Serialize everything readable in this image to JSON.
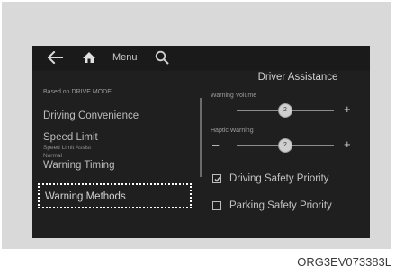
{
  "nav": {
    "menu_label": "Menu"
  },
  "panel": {
    "title": "Driver Assistance"
  },
  "left_menu": {
    "section_caption": "Based on DRIVE MODE",
    "items": [
      {
        "label": "Driving Convenience",
        "sub": ""
      },
      {
        "label": "Speed Limit",
        "sub": "Speed Limit Assist"
      },
      {
        "label": "Warning Timing",
        "sub": "Normal"
      },
      {
        "label": "Warning Methods",
        "sub": ""
      }
    ]
  },
  "right_panel": {
    "sliders": [
      {
        "label": "Warning Volume",
        "minus": "–",
        "plus": "+",
        "value": "2",
        "level": 2,
        "max": 4
      },
      {
        "label": "Haptic Warning",
        "minus": "–",
        "plus": "+",
        "value": "2",
        "level": 2,
        "max": 4
      }
    ],
    "options": [
      {
        "label": "Driving Safety Priority",
        "checked": true
      },
      {
        "label": "Parking Safety Priority",
        "checked": false
      }
    ]
  },
  "figure_code": "ORG3EV073383L",
  "colors": {
    "screen_bg": "#1f1f1f",
    "text": "#bdbdbd",
    "selection_border": "#ffffff"
  }
}
